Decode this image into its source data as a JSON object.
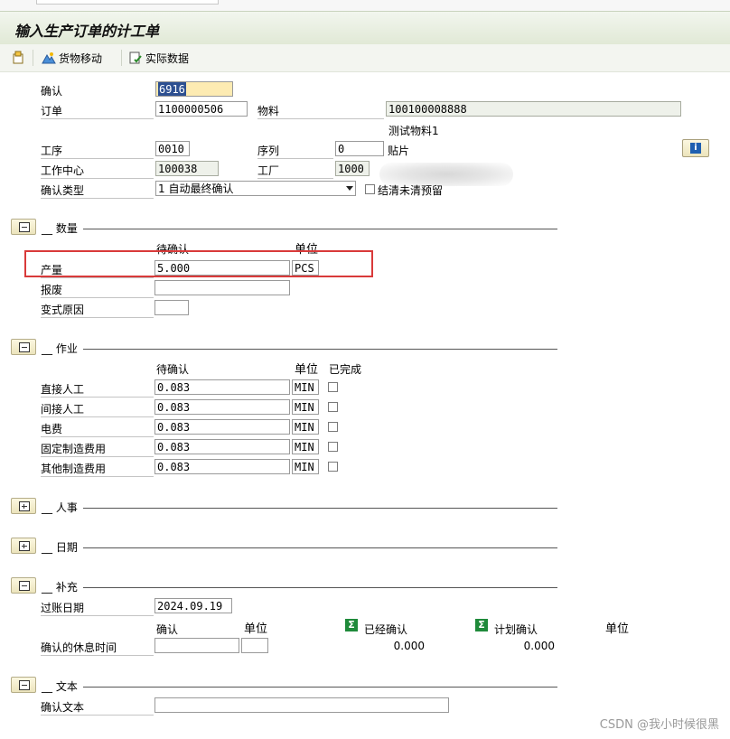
{
  "window": {
    "title": "输入生产订单的计工单"
  },
  "toolbar": {
    "goods_movement": "货物移动",
    "actual_data": "实际数据"
  },
  "header": {
    "confirmation_label": "确认",
    "confirmation_value": "6916",
    "order_label": "订单",
    "order_value": "1100000506",
    "material_label": "物料",
    "material_value": "100100008888",
    "material_desc": "测试物料1",
    "operation_label": "工序",
    "operation_value": "0010",
    "sequence_label": "序列",
    "sequence_value": "0",
    "sequence_desc": "贴片",
    "workcenter_label": "工作中心",
    "workcenter_value": "100038",
    "plant_label": "工厂",
    "plant_value": "1000",
    "conf_type_label": "确认类型",
    "conf_type_value": "1 自动最终确认",
    "clear_reservations_label": "结清未清预留"
  },
  "quantities": {
    "section_title": "数量",
    "col_to_confirm": "待确认",
    "col_unit": "单位",
    "yield_label": "产量",
    "yield_value": "5.000",
    "yield_unit": "PCS",
    "scrap_label": "报废",
    "scrap_value": "",
    "variance_label": "变式原因",
    "variance_value": ""
  },
  "activities": {
    "section_title": "作业",
    "col_to_confirm": "待确认",
    "col_unit": "单位",
    "col_done": "已完成",
    "rows": [
      {
        "label": "直接人工",
        "value": "0.083",
        "unit": "MIN"
      },
      {
        "label": "间接人工",
        "value": "0.083",
        "unit": "MIN"
      },
      {
        "label": "电费",
        "value": "0.083",
        "unit": "MIN"
      },
      {
        "label": "固定制造费用",
        "value": "0.083",
        "unit": "MIN"
      },
      {
        "label": "其他制造费用",
        "value": "0.083",
        "unit": "MIN"
      }
    ]
  },
  "personnel": {
    "section_title": "人事"
  },
  "dates": {
    "section_title": "日期"
  },
  "supplement": {
    "section_title": "补充",
    "posting_date_label": "过账日期",
    "posting_date_value": "2024.09.19",
    "col_confirm": "确认",
    "col_unit": "单位",
    "col_confirmed": "已经确认",
    "col_planned": "计划确认",
    "col_unit2": "单位",
    "break_time_label": "确认的休息时间",
    "confirmed_total": "0.000",
    "planned_total": "0.000"
  },
  "text": {
    "section_title": "文本",
    "conf_text_label": "确认文本",
    "conf_text_value": ""
  },
  "watermark": "CSDN @我小时候很黑",
  "colors": {
    "title_bg": "#e1e9d6",
    "focus_field": "#fdebb2",
    "highlight_box": "#d93a3a",
    "sigma": "#1f8a3a"
  }
}
